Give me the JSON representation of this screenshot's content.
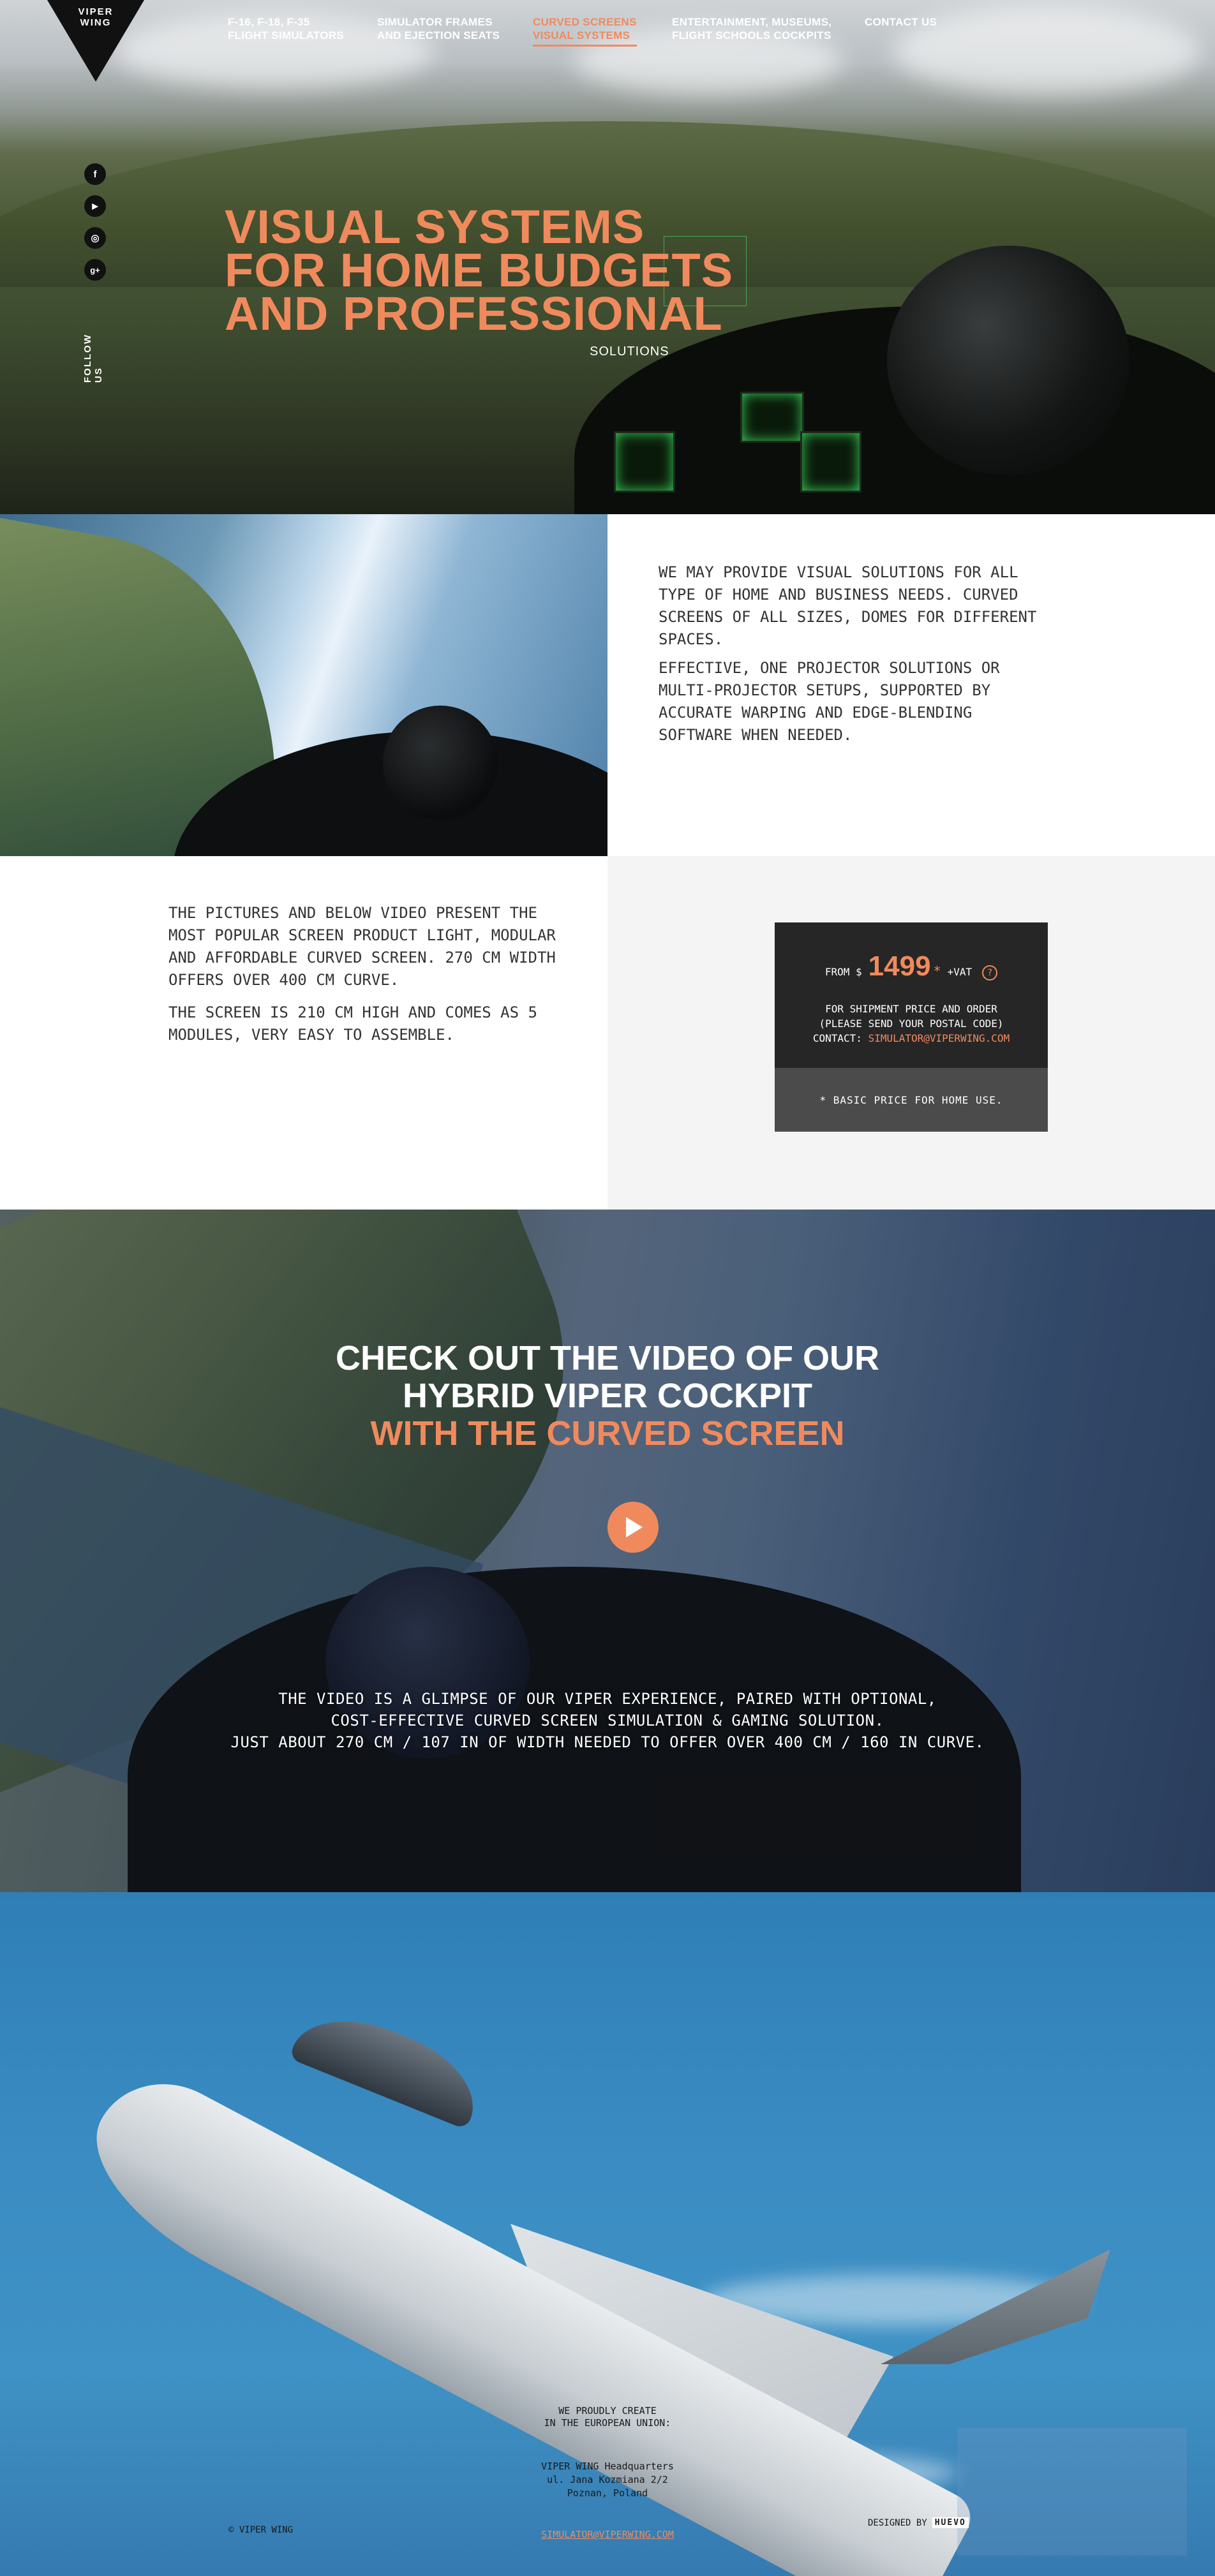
{
  "logo": {
    "line1": "VIPER",
    "line2": "WING"
  },
  "nav": [
    {
      "line1": "F-16, F-18, F-35",
      "line2": "FLIGHT SIMULATORS",
      "active": false
    },
    {
      "line1": "SIMULATOR FRAMES",
      "line2": "AND EJECTION SEATS",
      "active": false
    },
    {
      "line1": "CURVED SCREENS",
      "line2": "VISUAL SYSTEMS",
      "active": true
    },
    {
      "line1": "ENTERTAINMENT, MUSEUMS,",
      "line2": "FLIGHT SCHOOLS COCKPITS",
      "active": false
    },
    {
      "line1": "CONTACT US",
      "line2": "",
      "active": false
    }
  ],
  "social": {
    "icons": [
      {
        "name": "facebook-icon",
        "glyph": "f"
      },
      {
        "name": "youtube-icon",
        "glyph": "▶"
      },
      {
        "name": "instagram-icon",
        "glyph": "◎"
      },
      {
        "name": "google-plus-icon",
        "glyph": "g+"
      }
    ],
    "follow_label": "FOLLOW US"
  },
  "hero": {
    "title_line1": "VISUAL SYSTEMS",
    "title_line2": "FOR HOME BUDGETS",
    "title_line3": "AND PROFESSIONAL",
    "subtitle": "SOLUTIONS"
  },
  "section2": {
    "p1": "We may provide visual solutions for all type of home and business needs. Curved screens of all sizes, domes for different spaces.",
    "p2": "Effective, one projector solutions or multi-projector setups, supported by accurate warping and edge-blending software when needed."
  },
  "section3": {
    "p1": "The pictures and below video present the most popular screen product light, modular and affordable curved screen. 270 cm width offers over 400 cm curve.",
    "p2": "The screen is 210 cm high and comes as 5 modules, very easy to assemble."
  },
  "price": {
    "from_label": "FROM $",
    "value": "1499",
    "star": "*",
    "vat": "+VAT",
    "help": "?",
    "info1": "FOR SHIPMENT PRICE AND ORDER",
    "info2": "(PLEASE SEND YOUR POSTAL CODE)",
    "contact_label": "CONTACT:",
    "email": "SIMULATOR@VIPERWING.COM",
    "note": "* BASIC PRICE FOR HOME USE."
  },
  "video": {
    "title_line1": "CHECK OUT THE VIDEO OF OUR",
    "title_line2": "HYBRID VIPER COCKPIT",
    "title_line3": "WITH THE CURVED SCREEN",
    "desc_line1": "The video is a glimpse of our Viper experience, paired with optional,",
    "desc_line2": "cost-effective curved screen simulation & gaming solution.",
    "desc_line3": "Just about 270 cm / 107 in of width needed to offer over 400 cm / 160 in curve."
  },
  "footer": {
    "credit_line1": "WE PROUDLY CREATE",
    "credit_line2": "IN THE EUROPEAN UNION:",
    "address_line1": "VIPER WING Headquarters",
    "address_line2": "ul. Jana Kozmiana 2/2",
    "address_line3": "Poznan, Poland",
    "copyright": "© VIPER WING",
    "email": "SIMULATOR@VIPERWING.COM",
    "designed_label": "DESIGNED BY",
    "designer": "HUEVO"
  },
  "colors": {
    "accent": "#f08a5d",
    "dark": "#262626",
    "card_note_bg": "#4b4b4b"
  }
}
